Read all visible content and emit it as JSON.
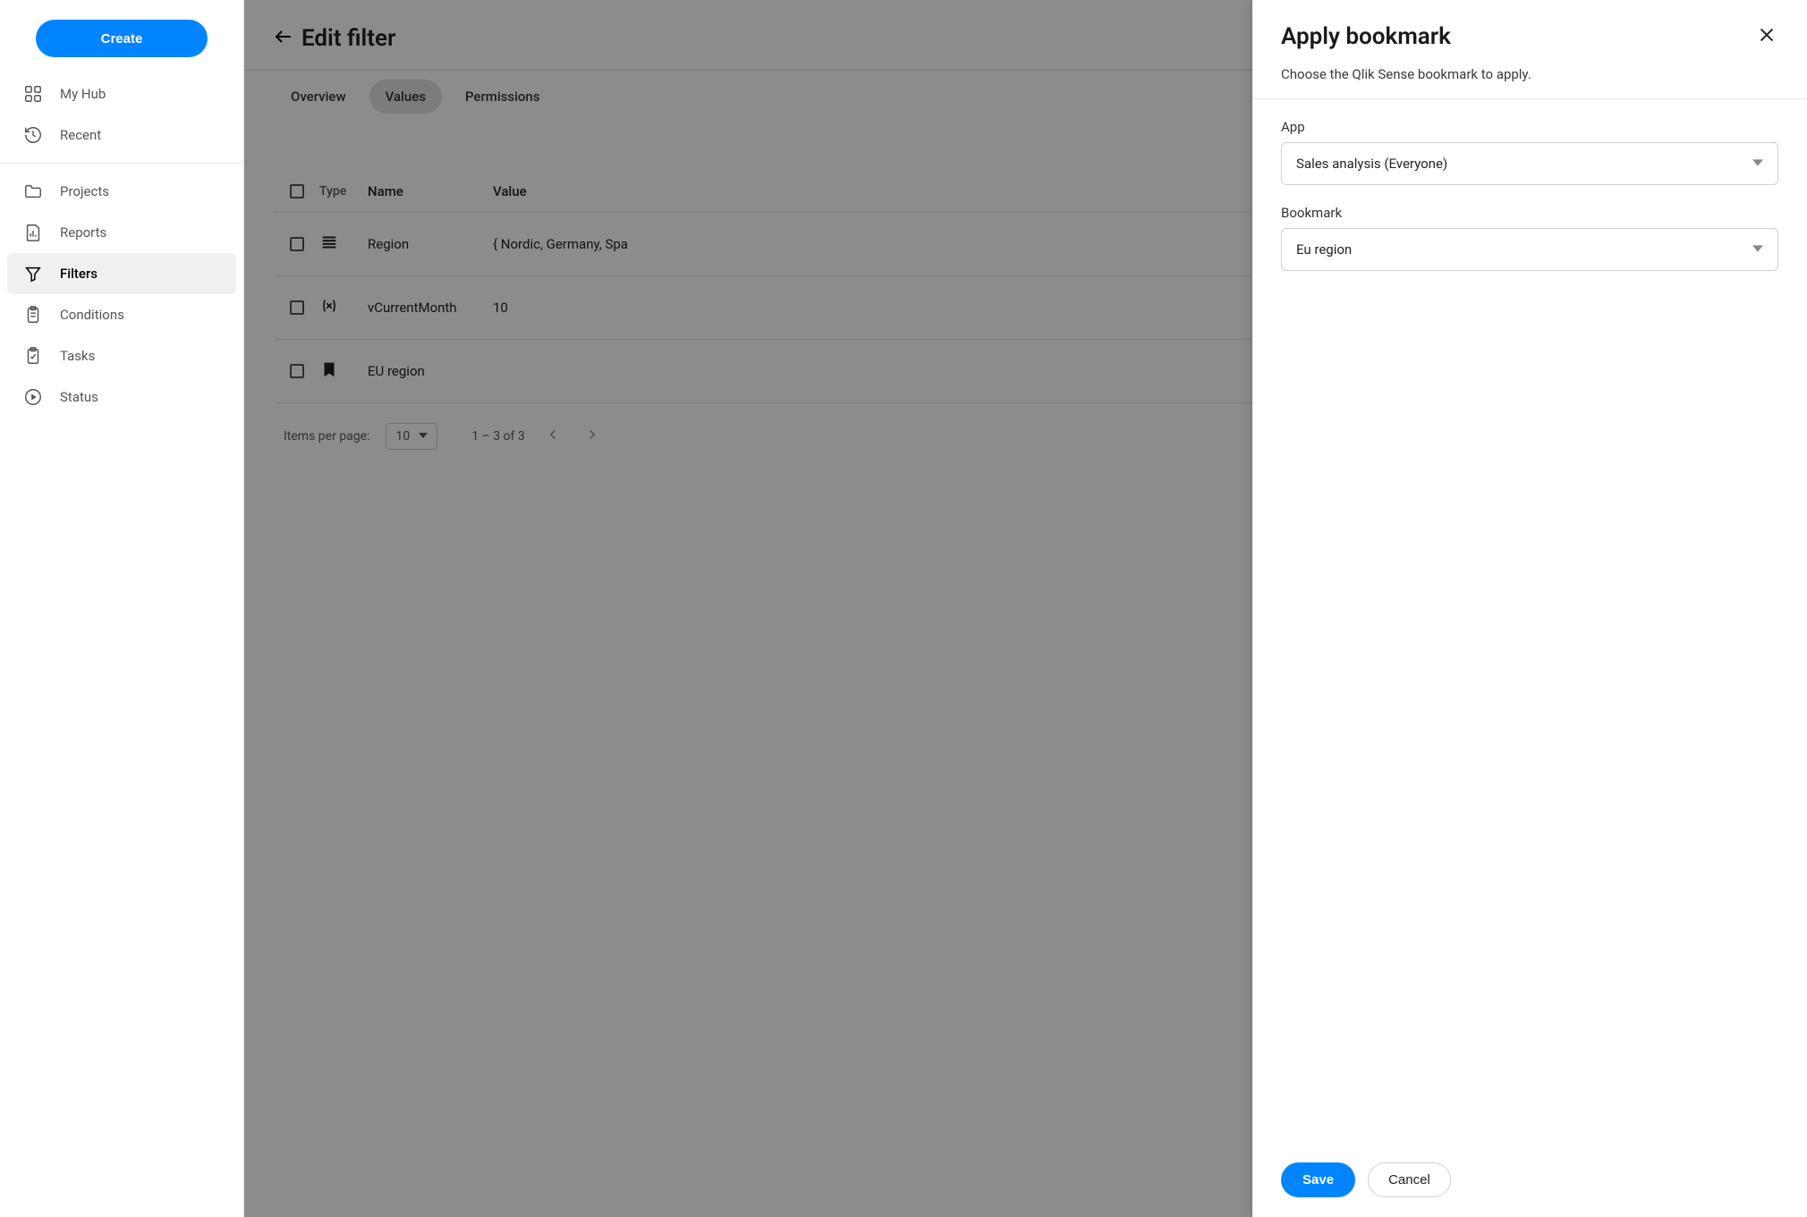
{
  "sidebar": {
    "create_label": "Create",
    "items_top": [
      {
        "label": "My Hub",
        "icon": "apps"
      },
      {
        "label": "Recent",
        "icon": "history"
      }
    ],
    "items_main": [
      {
        "label": "Projects",
        "icon": "folder"
      },
      {
        "label": "Reports",
        "icon": "report"
      },
      {
        "label": "Filters",
        "icon": "filter",
        "active": true
      },
      {
        "label": "Conditions",
        "icon": "clipboard"
      },
      {
        "label": "Tasks",
        "icon": "clipboard-check"
      },
      {
        "label": "Status",
        "icon": "play-circle"
      }
    ]
  },
  "page": {
    "title": "Edit filter",
    "tabs": [
      {
        "label": "Overview"
      },
      {
        "label": "Values",
        "active": true
      },
      {
        "label": "Permissions"
      }
    ]
  },
  "table": {
    "headers": {
      "type": "Type",
      "name": "Name",
      "value": "Value"
    },
    "rows": [
      {
        "icon": "list",
        "name": "Region",
        "value": "{ Nordic, Germany, Spa"
      },
      {
        "icon": "variable",
        "name": "vCurrentMonth",
        "value": "10"
      },
      {
        "icon": "bookmark",
        "name": "EU region",
        "value": ""
      }
    ]
  },
  "pager": {
    "label": "Items per page:",
    "size": "10",
    "range": "1 – 3 of 3"
  },
  "drawer": {
    "title": "Apply bookmark",
    "subtitle": "Choose the Qlik Sense bookmark to apply.",
    "app_label": "App",
    "app_value": "Sales analysis (Everyone)",
    "bookmark_label": "Bookmark",
    "bookmark_value": "Eu region",
    "save_label": "Save",
    "cancel_label": "Cancel"
  }
}
